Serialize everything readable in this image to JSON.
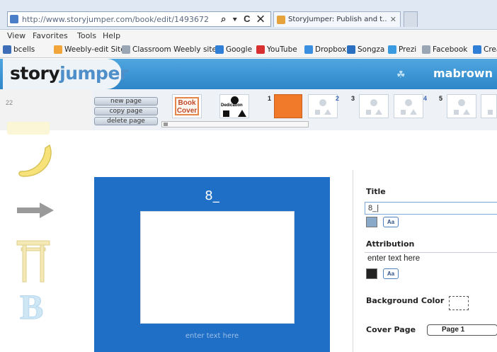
{
  "browser": {
    "url": "http://www.storyjumper.com/book/edit/1493672",
    "nav_controls": "⌕ ▾ C ✕",
    "tab_title": "StoryJumper: Publish and t...",
    "tab_close": "✕",
    "menu": [
      "View",
      "Favorites",
      "Tools",
      "Help"
    ],
    "bookmarks": [
      {
        "label": "bcells",
        "color": "#3e6fb6"
      },
      {
        "label": "Weebly-edit Site",
        "color": "#f2a53a"
      },
      {
        "label": "Classroom Weebly site",
        "color": "#9aa6b3"
      },
      {
        "label": "Google",
        "color": "#2f7fd6"
      },
      {
        "label": "YouTube",
        "color": "#d83030"
      },
      {
        "label": "Dropbox",
        "color": "#3b8fe0"
      },
      {
        "label": "Songza",
        "color": "#2a6fc0"
      },
      {
        "label": "Prezi",
        "color": "#3b9be0"
      },
      {
        "label": "Facebook",
        "color": "#9aa6b3"
      },
      {
        "label": "Crea",
        "color": "#2f7fd6"
      }
    ]
  },
  "app": {
    "logo_part1": "story",
    "logo_part2": "jumper",
    "username": "mabrown",
    "cart_icon": "ᴛ̲"
  },
  "toolbar": {
    "page_indicator": "22",
    "new_page": "new page",
    "copy_page": "copy page",
    "delete_page": "delete page",
    "book_cover": "Book\nCover",
    "dedication": "Dedication",
    "page_numbers": [
      "1",
      "2",
      "3",
      "4",
      "5"
    ]
  },
  "canvas": {
    "title": "8_",
    "attribution_placeholder": "enter text here",
    "background_color": "#1f6fc7"
  },
  "panel": {
    "title_label": "Title",
    "title_value": "8_|",
    "font_button": "Aa",
    "attribution_label": "Attribution",
    "attribution_value": "enter text here",
    "background_label": "Background Color",
    "cover_page_label": "Cover Page",
    "cover_page_value": "Page 1"
  }
}
